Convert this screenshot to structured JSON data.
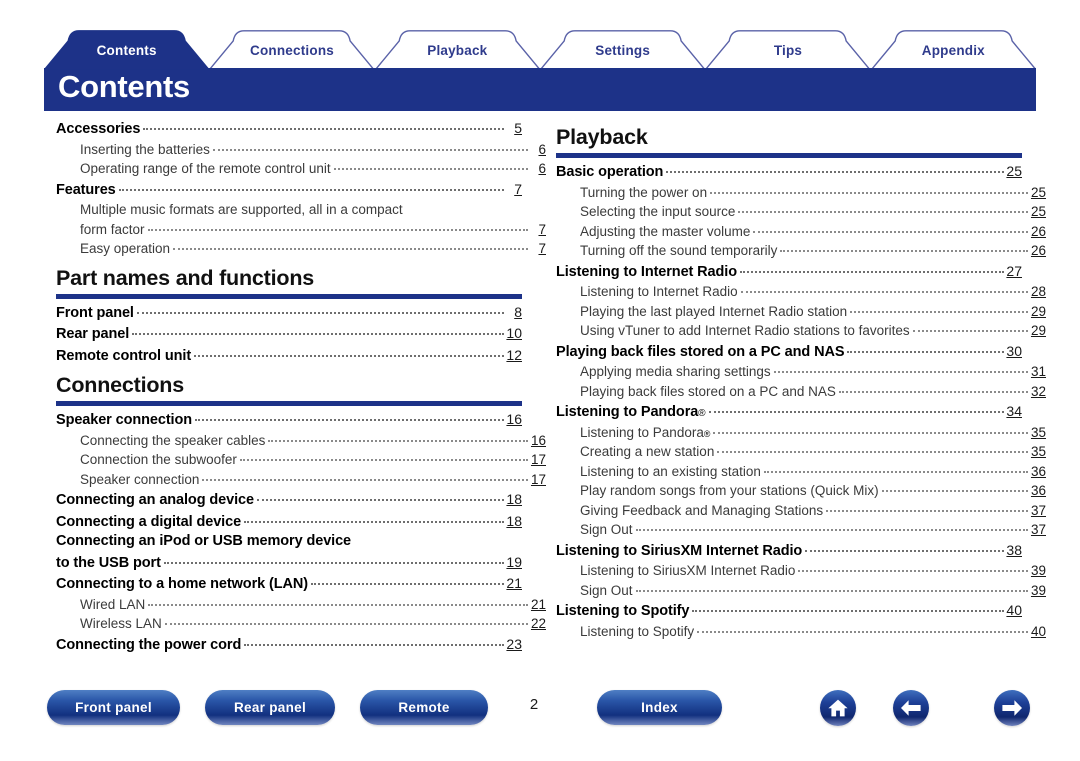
{
  "tabs": [
    {
      "label": "Contents",
      "active": true
    },
    {
      "label": "Connections",
      "active": false
    },
    {
      "label": "Playback",
      "active": false
    },
    {
      "label": "Settings",
      "active": false
    },
    {
      "label": "Tips",
      "active": false
    },
    {
      "label": "Appendix",
      "active": false
    }
  ],
  "banner": {
    "title": "Contents"
  },
  "colors": {
    "brand_blue": "#1d3288",
    "tab_text_inactive": "#2f3b8c",
    "tab_outline": "#5a62a8",
    "body_text": "#1a1a1a",
    "sub_text": "#3b3b3b",
    "dot_leader": "#8a8a8a"
  },
  "left_column": [
    {
      "heading": null,
      "rule": false,
      "entries": [
        {
          "level": 1,
          "text": "Accessories",
          "page": "5"
        },
        {
          "level": 2,
          "text": "Inserting the batteries",
          "page": "6"
        },
        {
          "level": 2,
          "text": "Operating range of the remote control unit",
          "page": "6"
        },
        {
          "level": 1,
          "text": "Features",
          "page": "7"
        },
        {
          "level": 2,
          "text": "Multiple music formats are supported, all in a compact",
          "wrap_next": "form factor",
          "page": "7"
        },
        {
          "level": 2,
          "text": "Easy operation",
          "page": "7"
        }
      ]
    },
    {
      "heading": "Part names and functions",
      "rule": true,
      "entries": [
        {
          "level": 1,
          "text": "Front panel",
          "page": "8"
        },
        {
          "level": 1,
          "text": "Rear panel",
          "page": "10"
        },
        {
          "level": 1,
          "text": "Remote control unit",
          "page": "12"
        }
      ]
    },
    {
      "heading": "Connections",
      "rule": true,
      "entries": [
        {
          "level": 1,
          "text": "Speaker connection",
          "page": "16"
        },
        {
          "level": 2,
          "text": "Connecting the speaker cables",
          "page": "16"
        },
        {
          "level": 2,
          "text": "Connection the subwoofer",
          "page": "17"
        },
        {
          "level": 2,
          "text": "Speaker connection",
          "page": "17"
        },
        {
          "level": 1,
          "text": "Connecting an analog device",
          "page": "18"
        },
        {
          "level": 1,
          "text": "Connecting a digital device",
          "page": "18"
        },
        {
          "level": 1,
          "text": "Connecting an iPod or USB memory device",
          "wrap_next": "to the USB port",
          "page": "19"
        },
        {
          "level": 1,
          "text": "Connecting to a home network (LAN)",
          "page": "21"
        },
        {
          "level": 2,
          "text": "Wired LAN",
          "page": "21"
        },
        {
          "level": 2,
          "text": "Wireless LAN",
          "page": "22"
        },
        {
          "level": 1,
          "text": "Connecting the power cord",
          "page": "23"
        }
      ]
    }
  ],
  "right_column": [
    {
      "heading": "Playback",
      "rule": true,
      "entries": [
        {
          "level": 1,
          "text": "Basic operation",
          "page": "25"
        },
        {
          "level": 2,
          "text": "Turning the power on",
          "page": "25"
        },
        {
          "level": 2,
          "text": "Selecting the input source",
          "page": "25"
        },
        {
          "level": 2,
          "text": "Adjusting the master volume",
          "page": "26"
        },
        {
          "level": 2,
          "text": "Turning off the sound temporarily",
          "page": "26"
        },
        {
          "level": 1,
          "text": "Listening to Internet Radio",
          "page": "27"
        },
        {
          "level": 2,
          "text": "Listening to Internet Radio",
          "page": "28"
        },
        {
          "level": 2,
          "text": "Playing the last played Internet Radio station",
          "page": "29"
        },
        {
          "level": 2,
          "text": "Using vTuner to add Internet Radio stations to favorites",
          "page": "29"
        },
        {
          "level": 1,
          "text": "Playing back files stored on a PC and NAS",
          "page": "30"
        },
        {
          "level": 2,
          "text": "Applying media sharing settings",
          "page": "31"
        },
        {
          "level": 2,
          "text": "Playing back files stored on a PC and NAS",
          "page": "32"
        },
        {
          "level": 1,
          "text": "Listening to Pandora",
          "sup": "®",
          "page": "34"
        },
        {
          "level": 2,
          "text": "Listening to Pandora",
          "sup": "®",
          "page": "35"
        },
        {
          "level": 2,
          "text": "Creating a new station",
          "page": "35"
        },
        {
          "level": 2,
          "text": "Listening to an existing station",
          "page": "36"
        },
        {
          "level": 2,
          "text": "Play random songs from your stations (Quick Mix)",
          "page": "36"
        },
        {
          "level": 2,
          "text": "Giving Feedback and Managing Stations",
          "page": "37"
        },
        {
          "level": 2,
          "text": "Sign Out",
          "page": "37"
        },
        {
          "level": 1,
          "text": "Listening to SiriusXM Internet Radio",
          "page": "38"
        },
        {
          "level": 2,
          "text": "Listening to SiriusXM Internet Radio",
          "page": "39"
        },
        {
          "level": 2,
          "text": "Sign Out",
          "page": "39"
        },
        {
          "level": 1,
          "text": "Listening to Spotify",
          "page": "40"
        },
        {
          "level": 2,
          "text": "Listening to Spotify",
          "page": "40"
        }
      ]
    }
  ],
  "footer": {
    "buttons": [
      {
        "id": "front",
        "label": "Front panel"
      },
      {
        "id": "rear",
        "label": "Rear panel"
      },
      {
        "id": "remote",
        "label": "Remote"
      },
      {
        "id": "index",
        "label": "Index"
      }
    ],
    "page_number": "2",
    "icons": [
      {
        "id": "home",
        "name": "home-icon"
      },
      {
        "id": "back",
        "name": "arrow-left-icon"
      },
      {
        "id": "next",
        "name": "arrow-right-icon"
      }
    ]
  }
}
